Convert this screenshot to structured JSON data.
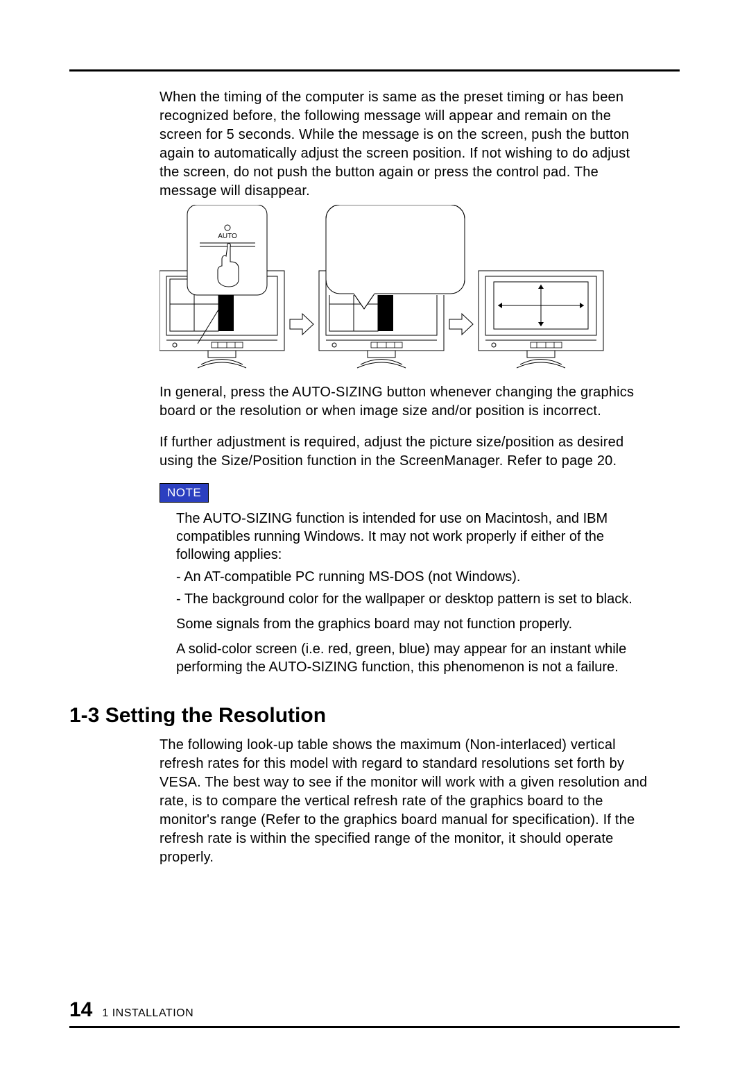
{
  "paragraph1": "When the timing of the computer is same as the preset timing or has been recognized before, the following message will appear and remain on the screen for 5 seconds.  While the message is on the screen, push the button again to automatically adjust the screen position.  If not wishing to do adjust the screen, do not push the button again or press the control pad.  The message will disappear.",
  "auto_label": "AUTO",
  "paragraph2": "In general, press the AUTO-SIZING button whenever changing the graphics board or the resolution or when image size and/or position is incorrect.",
  "paragraph3": "If further adjustment is required, adjust the picture size/position as desired using the Size/Position function in the ScreenManager.  Refer to page 20.",
  "note_label": "NOTE",
  "note_p1": "The AUTO-SIZING function is intended for use on Macintosh, and IBM compatibles running Windows. It may not work properly if either of the following applies:",
  "note_b1": "-  An AT-compatible PC running MS-DOS (not Windows).",
  "note_b2": "-  The background color for the  wallpaper  or  desktop  pattern is set to black.",
  "note_p2": "Some signals from the graphics board may not function properly.",
  "note_p3": "A solid-color screen (i.e. red, green, blue) may appear for an instant while performing the AUTO-SIZING function, this phenomenon is not a failure.",
  "heading": "1-3 Setting the Resolution",
  "paragraph4": "The following look-up table shows the maximum (Non-interlaced) vertical refresh rates for this model with regard to standard resolutions set forth by VESA.  The best way to see if the monitor will work with a given resolution and rate, is to compare the vertical refresh rate of the graphics board to the monitor's range (Refer to the graphics board manual for specification).  If the refresh rate is within the specified range of the monitor, it should operate properly.",
  "page_number": "14",
  "footer_text": "1   INSTALLATION"
}
